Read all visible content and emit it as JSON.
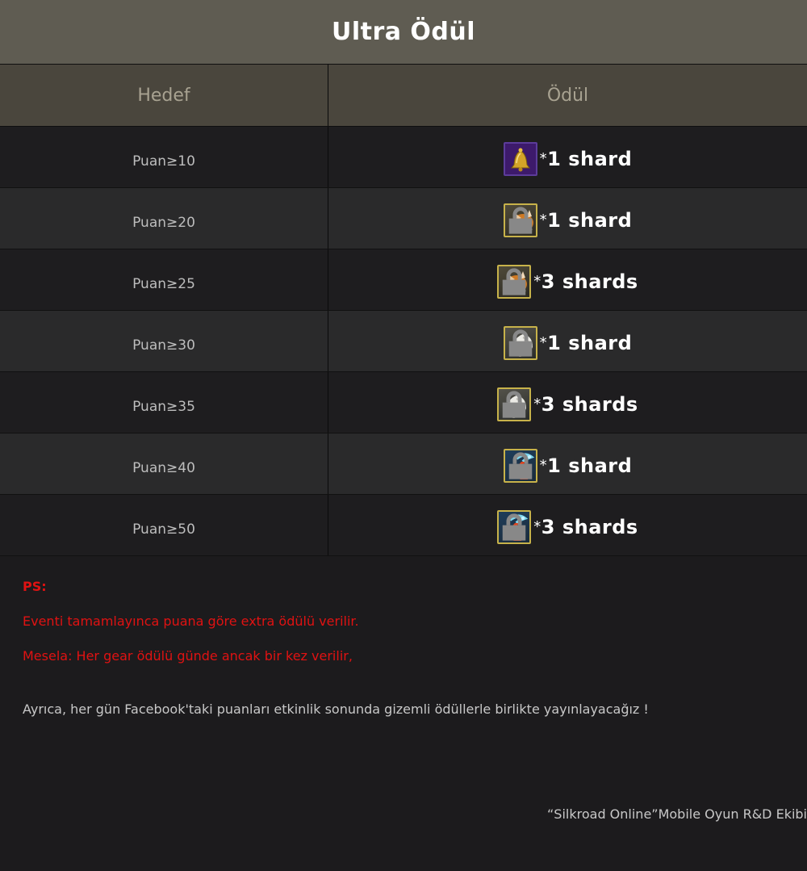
{
  "title": "Ultra Ödül",
  "table": {
    "headers": {
      "target": "Hedef",
      "reward": "Ödül"
    },
    "rows": [
      {
        "target": "Puan≥10",
        "icon": "bell-icon",
        "amount": "1 shard"
      },
      {
        "target": "Puan≥20",
        "icon": "dragon-pet-icon",
        "amount": "1 shard"
      },
      {
        "target": "Puan≥25",
        "icon": "dragon-pet-icon",
        "amount": "3 shards"
      },
      {
        "target": "Puan≥30",
        "icon": "griffin-pet-icon",
        "amount": "1 shard"
      },
      {
        "target": "Puan≥35",
        "icon": "griffin-pet-icon",
        "amount": "3 shards"
      },
      {
        "target": "Puan≥40",
        "icon": "phoenix-pet-icon",
        "amount": "1 shard"
      },
      {
        "target": "Puan≥50",
        "icon": "phoenix-pet-icon",
        "amount": "3 shards"
      }
    ],
    "multiplier_symbol": "*"
  },
  "notes": {
    "ps": "PS:",
    "line1": "Eventi tamamlayınca puana göre extra ödülü verilir.",
    "line2": "Mesela: Her gear ödülü günde ancak bir kez verilir,",
    "info": "Ayrıca, her gün Facebook'taki puanları etkinlik sonunda gizemli ödüllerle birlikte yayınlayacağız !"
  },
  "footer": "“Silkroad Online”Mobile Oyun R&D Ekibi",
  "colors": {
    "title_bg": "#5f5c52",
    "header_bg": "#4a463d",
    "row_dark": "#1e1d1f",
    "row_light": "#2a2a2b",
    "note_red": "#e01212"
  }
}
